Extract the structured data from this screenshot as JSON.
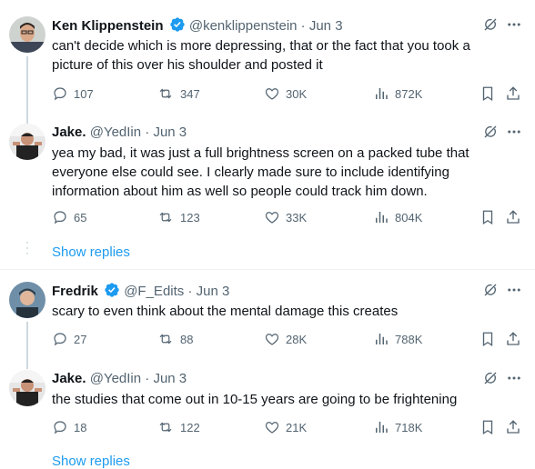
{
  "tweets": [
    {
      "name": "Ken Klippenstein",
      "verified": true,
      "handle": "@kenklippenstein",
      "date": "Jun 3",
      "text": "can't decide which is more depressing, that or the fact that you took a picture of this over his shoulder and posted it",
      "replies": "107",
      "retweets": "347",
      "likes": "30K",
      "views": "872K"
    },
    {
      "name": "Jake.",
      "verified": false,
      "handle": "@YedIin",
      "date": "Jun 3",
      "text": "yea my bad, it was just a full brightness screen on a packed tube that everyone else could see. I clearly made sure to include identifying information about him as well so people could track him down.",
      "replies": "65",
      "retweets": "123",
      "likes": "33K",
      "views": "804K"
    },
    {
      "name": "Fredrik",
      "verified": true,
      "handle": "@F_Edits",
      "date": "Jun 3",
      "text": "scary to even think about the mental damage this creates",
      "replies": "27",
      "retweets": "88",
      "likes": "28K",
      "views": "788K"
    },
    {
      "name": "Jake.",
      "verified": false,
      "handle": "@YedIin",
      "date": "Jun 3",
      "text": "the studies that come out in 10-15 years are going to be frightening",
      "replies": "18",
      "retweets": "122",
      "likes": "21K",
      "views": "718K"
    }
  ],
  "show_replies_label": "Show replies",
  "separator": "·",
  "colors": {
    "accent": "#1d9bf0",
    "secondary_text": "#536471",
    "divider": "#eff3f4"
  }
}
